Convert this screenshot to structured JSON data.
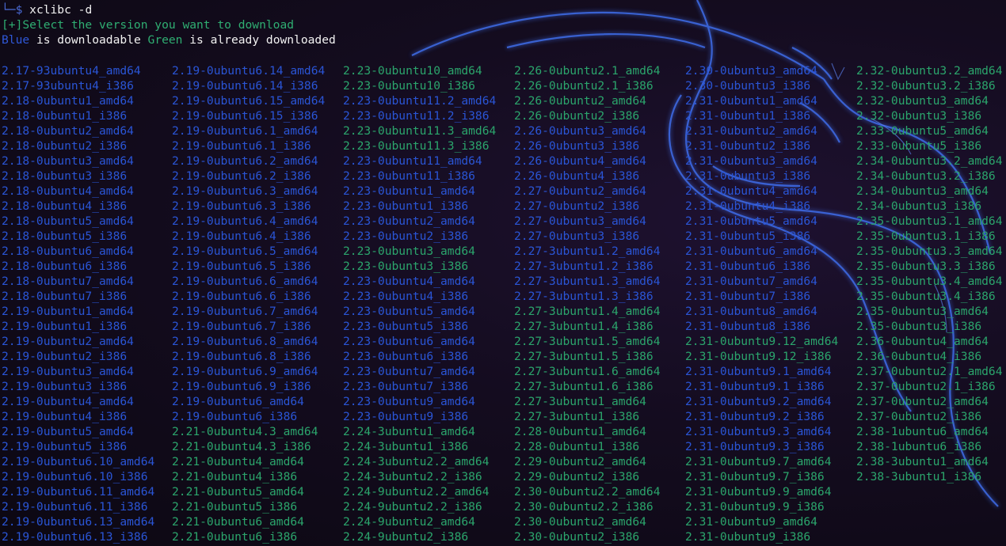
{
  "terminal": {
    "prompt_symbol": "└─$",
    "command": "xclibc -d",
    "message": "[+]Select the version you want to download",
    "legend": {
      "blue_word": "Blue",
      "blue_text": " is downloadable ",
      "green_word": "Green",
      "green_text": " is already downloaded"
    }
  },
  "colors": {
    "downloadable": "#2a55d6",
    "downloaded": "#2ba56c"
  },
  "columns": [
    {
      "items": [
        {
          "label": "2.17-93ubuntu4_amd64",
          "status": "blue"
        },
        {
          "label": "2.17-93ubuntu4_i386",
          "status": "blue"
        },
        {
          "label": "2.18-0ubuntu1_amd64",
          "status": "blue"
        },
        {
          "label": "2.18-0ubuntu1_i386",
          "status": "blue"
        },
        {
          "label": "2.18-0ubuntu2_amd64",
          "status": "blue"
        },
        {
          "label": "2.18-0ubuntu2_i386",
          "status": "blue"
        },
        {
          "label": "2.18-0ubuntu3_amd64",
          "status": "blue"
        },
        {
          "label": "2.18-0ubuntu3_i386",
          "status": "blue"
        },
        {
          "label": "2.18-0ubuntu4_amd64",
          "status": "blue"
        },
        {
          "label": "2.18-0ubuntu4_i386",
          "status": "blue"
        },
        {
          "label": "2.18-0ubuntu5_amd64",
          "status": "blue"
        },
        {
          "label": "2.18-0ubuntu5_i386",
          "status": "blue"
        },
        {
          "label": "2.18-0ubuntu6_amd64",
          "status": "blue"
        },
        {
          "label": "2.18-0ubuntu6_i386",
          "status": "blue"
        },
        {
          "label": "2.18-0ubuntu7_amd64",
          "status": "blue"
        },
        {
          "label": "2.18-0ubuntu7_i386",
          "status": "blue"
        },
        {
          "label": "2.19-0ubuntu1_amd64",
          "status": "blue"
        },
        {
          "label": "2.19-0ubuntu1_i386",
          "status": "blue"
        },
        {
          "label": "2.19-0ubuntu2_amd64",
          "status": "blue"
        },
        {
          "label": "2.19-0ubuntu2_i386",
          "status": "blue"
        },
        {
          "label": "2.19-0ubuntu3_amd64",
          "status": "blue"
        },
        {
          "label": "2.19-0ubuntu3_i386",
          "status": "blue"
        },
        {
          "label": "2.19-0ubuntu4_amd64",
          "status": "blue"
        },
        {
          "label": "2.19-0ubuntu4_i386",
          "status": "blue"
        },
        {
          "label": "2.19-0ubuntu5_amd64",
          "status": "blue"
        },
        {
          "label": "2.19-0ubuntu5_i386",
          "status": "blue"
        },
        {
          "label": "2.19-0ubuntu6.10_amd64",
          "status": "blue"
        },
        {
          "label": "2.19-0ubuntu6.10_i386",
          "status": "blue"
        },
        {
          "label": "2.19-0ubuntu6.11_amd64",
          "status": "blue"
        },
        {
          "label": "2.19-0ubuntu6.11_i386",
          "status": "blue"
        },
        {
          "label": "2.19-0ubuntu6.13_amd64",
          "status": "blue"
        },
        {
          "label": "2.19-0ubuntu6.13_i386",
          "status": "blue"
        }
      ]
    },
    {
      "items": [
        {
          "label": "2.19-0ubuntu6.14_amd64",
          "status": "blue"
        },
        {
          "label": "2.19-0ubuntu6.14_i386",
          "status": "blue"
        },
        {
          "label": "2.19-0ubuntu6.15_amd64",
          "status": "blue"
        },
        {
          "label": "2.19-0ubuntu6.15_i386",
          "status": "blue"
        },
        {
          "label": "2.19-0ubuntu6.1_amd64",
          "status": "blue"
        },
        {
          "label": "2.19-0ubuntu6.1_i386",
          "status": "blue"
        },
        {
          "label": "2.19-0ubuntu6.2_amd64",
          "status": "blue"
        },
        {
          "label": "2.19-0ubuntu6.2_i386",
          "status": "blue"
        },
        {
          "label": "2.19-0ubuntu6.3_amd64",
          "status": "blue"
        },
        {
          "label": "2.19-0ubuntu6.3_i386",
          "status": "blue"
        },
        {
          "label": "2.19-0ubuntu6.4_amd64",
          "status": "blue"
        },
        {
          "label": "2.19-0ubuntu6.4_i386",
          "status": "blue"
        },
        {
          "label": "2.19-0ubuntu6.5_amd64",
          "status": "blue"
        },
        {
          "label": "2.19-0ubuntu6.5_i386",
          "status": "blue"
        },
        {
          "label": "2.19-0ubuntu6.6_amd64",
          "status": "blue"
        },
        {
          "label": "2.19-0ubuntu6.6_i386",
          "status": "blue"
        },
        {
          "label": "2.19-0ubuntu6.7_amd64",
          "status": "blue"
        },
        {
          "label": "2.19-0ubuntu6.7_i386",
          "status": "blue"
        },
        {
          "label": "2.19-0ubuntu6.8_amd64",
          "status": "blue"
        },
        {
          "label": "2.19-0ubuntu6.8_i386",
          "status": "blue"
        },
        {
          "label": "2.19-0ubuntu6.9_amd64",
          "status": "blue"
        },
        {
          "label": "2.19-0ubuntu6.9_i386",
          "status": "blue"
        },
        {
          "label": "2.19-0ubuntu6_amd64",
          "status": "blue"
        },
        {
          "label": "2.19-0ubuntu6_i386",
          "status": "blue"
        },
        {
          "label": "2.21-0ubuntu4.3_amd64",
          "status": "green"
        },
        {
          "label": "2.21-0ubuntu4.3_i386",
          "status": "green"
        },
        {
          "label": "2.21-0ubuntu4_amd64",
          "status": "green"
        },
        {
          "label": "2.21-0ubuntu4_i386",
          "status": "green"
        },
        {
          "label": "2.21-0ubuntu5_amd64",
          "status": "green"
        },
        {
          "label": "2.21-0ubuntu5_i386",
          "status": "green"
        },
        {
          "label": "2.21-0ubuntu6_amd64",
          "status": "green"
        },
        {
          "label": "2.21-0ubuntu6_i386",
          "status": "green"
        }
      ]
    },
    {
      "items": [
        {
          "label": "2.23-0ubuntu10_amd64",
          "status": "green"
        },
        {
          "label": "2.23-0ubuntu10_i386",
          "status": "green"
        },
        {
          "label": "2.23-0ubuntu11.2_amd64",
          "status": "blue"
        },
        {
          "label": "2.23-0ubuntu11.2_i386",
          "status": "blue"
        },
        {
          "label": "2.23-0ubuntu11.3_amd64",
          "status": "green"
        },
        {
          "label": "2.23-0ubuntu11.3_i386",
          "status": "green"
        },
        {
          "label": "2.23-0ubuntu11_amd64",
          "status": "blue"
        },
        {
          "label": "2.23-0ubuntu11_i386",
          "status": "blue"
        },
        {
          "label": "2.23-0ubuntu1_amd64",
          "status": "blue"
        },
        {
          "label": "2.23-0ubuntu1_i386",
          "status": "blue"
        },
        {
          "label": "2.23-0ubuntu2_amd64",
          "status": "blue"
        },
        {
          "label": "2.23-0ubuntu2_i386",
          "status": "blue"
        },
        {
          "label": "2.23-0ubuntu3_amd64",
          "status": "green"
        },
        {
          "label": "2.23-0ubuntu3_i386",
          "status": "green"
        },
        {
          "label": "2.23-0ubuntu4_amd64",
          "status": "blue"
        },
        {
          "label": "2.23-0ubuntu4_i386",
          "status": "blue"
        },
        {
          "label": "2.23-0ubuntu5_amd64",
          "status": "blue"
        },
        {
          "label": "2.23-0ubuntu5_i386",
          "status": "blue"
        },
        {
          "label": "2.23-0ubuntu6_amd64",
          "status": "blue"
        },
        {
          "label": "2.23-0ubuntu6_i386",
          "status": "blue"
        },
        {
          "label": "2.23-0ubuntu7_amd64",
          "status": "blue"
        },
        {
          "label": "2.23-0ubuntu7_i386",
          "status": "blue"
        },
        {
          "label": "2.23-0ubuntu9_amd64",
          "status": "blue"
        },
        {
          "label": "2.23-0ubuntu9_i386",
          "status": "blue"
        },
        {
          "label": "2.24-3ubuntu1_amd64",
          "status": "green"
        },
        {
          "label": "2.24-3ubuntu1_i386",
          "status": "green"
        },
        {
          "label": "2.24-3ubuntu2.2_amd64",
          "status": "green"
        },
        {
          "label": "2.24-3ubuntu2.2_i386",
          "status": "green"
        },
        {
          "label": "2.24-9ubuntu2.2_amd64",
          "status": "green"
        },
        {
          "label": "2.24-9ubuntu2.2_i386",
          "status": "green"
        },
        {
          "label": "2.24-9ubuntu2_amd64",
          "status": "green"
        },
        {
          "label": "2.24-9ubuntu2_i386",
          "status": "green"
        }
      ]
    },
    {
      "items": [
        {
          "label": "2.26-0ubuntu2.1_amd64",
          "status": "green"
        },
        {
          "label": "2.26-0ubuntu2.1_i386",
          "status": "green"
        },
        {
          "label": "2.26-0ubuntu2_amd64",
          "status": "green"
        },
        {
          "label": "2.26-0ubuntu2_i386",
          "status": "green"
        },
        {
          "label": "2.26-0ubuntu3_amd64",
          "status": "blue"
        },
        {
          "label": "2.26-0ubuntu3_i386",
          "status": "blue"
        },
        {
          "label": "2.26-0ubuntu4_amd64",
          "status": "blue"
        },
        {
          "label": "2.26-0ubuntu4_i386",
          "status": "blue"
        },
        {
          "label": "2.27-0ubuntu2_amd64",
          "status": "blue"
        },
        {
          "label": "2.27-0ubuntu2_i386",
          "status": "blue"
        },
        {
          "label": "2.27-0ubuntu3_amd64",
          "status": "blue"
        },
        {
          "label": "2.27-0ubuntu3_i386",
          "status": "blue"
        },
        {
          "label": "2.27-3ubuntu1.2_amd64",
          "status": "blue"
        },
        {
          "label": "2.27-3ubuntu1.2_i386",
          "status": "blue"
        },
        {
          "label": "2.27-3ubuntu1.3_amd64",
          "status": "blue"
        },
        {
          "label": "2.27-3ubuntu1.3_i386",
          "status": "blue"
        },
        {
          "label": "2.27-3ubuntu1.4_amd64",
          "status": "green"
        },
        {
          "label": "2.27-3ubuntu1.4_i386",
          "status": "green"
        },
        {
          "label": "2.27-3ubuntu1.5_amd64",
          "status": "green"
        },
        {
          "label": "2.27-3ubuntu1.5_i386",
          "status": "green"
        },
        {
          "label": "2.27-3ubuntu1.6_amd64",
          "status": "green"
        },
        {
          "label": "2.27-3ubuntu1.6_i386",
          "status": "green"
        },
        {
          "label": "2.27-3ubuntu1_amd64",
          "status": "green"
        },
        {
          "label": "2.27-3ubuntu1_i386",
          "status": "green"
        },
        {
          "label": "2.28-0ubuntu1_amd64",
          "status": "green"
        },
        {
          "label": "2.28-0ubuntu1_i386",
          "status": "green"
        },
        {
          "label": "2.29-0ubuntu2_amd64",
          "status": "green"
        },
        {
          "label": "2.29-0ubuntu2_i386",
          "status": "green"
        },
        {
          "label": "2.30-0ubuntu2.2_amd64",
          "status": "green"
        },
        {
          "label": "2.30-0ubuntu2.2_i386",
          "status": "green"
        },
        {
          "label": "2.30-0ubuntu2_amd64",
          "status": "green"
        },
        {
          "label": "2.30-0ubuntu2_i386",
          "status": "green"
        }
      ]
    },
    {
      "items": [
        {
          "label": "2.30-0ubuntu3_amd64",
          "status": "blue"
        },
        {
          "label": "2.30-0ubuntu3_i386",
          "status": "blue"
        },
        {
          "label": "2.31-0ubuntu1_amd64",
          "status": "blue"
        },
        {
          "label": "2.31-0ubuntu1_i386",
          "status": "blue"
        },
        {
          "label": "2.31-0ubuntu2_amd64",
          "status": "blue"
        },
        {
          "label": "2.31-0ubuntu2_i386",
          "status": "blue"
        },
        {
          "label": "2.31-0ubuntu3_amd64",
          "status": "blue"
        },
        {
          "label": "2.31-0ubuntu3_i386",
          "status": "blue"
        },
        {
          "label": "2.31-0ubuntu4_amd64",
          "status": "blue"
        },
        {
          "label": "2.31-0ubuntu4_i386",
          "status": "blue"
        },
        {
          "label": "2.31-0ubuntu5_amd64",
          "status": "blue"
        },
        {
          "label": "2.31-0ubuntu5_i386",
          "status": "blue"
        },
        {
          "label": "2.31-0ubuntu6_amd64",
          "status": "blue"
        },
        {
          "label": "2.31-0ubuntu6_i386",
          "status": "blue"
        },
        {
          "label": "2.31-0ubuntu7_amd64",
          "status": "blue"
        },
        {
          "label": "2.31-0ubuntu7_i386",
          "status": "blue"
        },
        {
          "label": "2.31-0ubuntu8_amd64",
          "status": "blue"
        },
        {
          "label": "2.31-0ubuntu8_i386",
          "status": "blue"
        },
        {
          "label": "2.31-0ubuntu9.12_amd64",
          "status": "green"
        },
        {
          "label": "2.31-0ubuntu9.12_i386",
          "status": "green"
        },
        {
          "label": "2.31-0ubuntu9.1_amd64",
          "status": "blue"
        },
        {
          "label": "2.31-0ubuntu9.1_i386",
          "status": "blue"
        },
        {
          "label": "2.31-0ubuntu9.2_amd64",
          "status": "blue"
        },
        {
          "label": "2.31-0ubuntu9.2_i386",
          "status": "blue"
        },
        {
          "label": "2.31-0ubuntu9.3_amd64",
          "status": "blue"
        },
        {
          "label": "2.31-0ubuntu9.3_i386",
          "status": "blue"
        },
        {
          "label": "2.31-0ubuntu9.7_amd64",
          "status": "green"
        },
        {
          "label": "2.31-0ubuntu9.7_i386",
          "status": "green"
        },
        {
          "label": "2.31-0ubuntu9.9_amd64",
          "status": "green"
        },
        {
          "label": "2.31-0ubuntu9.9_i386",
          "status": "green"
        },
        {
          "label": "2.31-0ubuntu9_amd64",
          "status": "green"
        },
        {
          "label": "2.31-0ubuntu9_i386",
          "status": "green"
        }
      ]
    },
    {
      "items": [
        {
          "label": "2.32-0ubuntu3.2_amd64",
          "status": "green"
        },
        {
          "label": "2.32-0ubuntu3.2_i386",
          "status": "green"
        },
        {
          "label": "2.32-0ubuntu3_amd64",
          "status": "green"
        },
        {
          "label": "2.32-0ubuntu3_i386",
          "status": "green"
        },
        {
          "label": "2.33-0ubuntu5_amd64",
          "status": "green"
        },
        {
          "label": "2.33-0ubuntu5_i386",
          "status": "green"
        },
        {
          "label": "2.34-0ubuntu3.2_amd64",
          "status": "green"
        },
        {
          "label": "2.34-0ubuntu3.2_i386",
          "status": "green"
        },
        {
          "label": "2.34-0ubuntu3_amd64",
          "status": "green"
        },
        {
          "label": "2.34-0ubuntu3_i386",
          "status": "green"
        },
        {
          "label": "2.35-0ubuntu3.1_amd64",
          "status": "green"
        },
        {
          "label": "2.35-0ubuntu3.1_i386",
          "status": "green"
        },
        {
          "label": "2.35-0ubuntu3.3_amd64",
          "status": "green"
        },
        {
          "label": "2.35-0ubuntu3.3_i386",
          "status": "green"
        },
        {
          "label": "2.35-0ubuntu3.4_amd64",
          "status": "green"
        },
        {
          "label": "2.35-0ubuntu3.4_i386",
          "status": "green"
        },
        {
          "label": "2.35-0ubuntu3_amd64",
          "status": "green"
        },
        {
          "label": "2.35-0ubuntu3_i386",
          "status": "green"
        },
        {
          "label": "2.36-0ubuntu4_amd64",
          "status": "green"
        },
        {
          "label": "2.36-0ubuntu4_i386",
          "status": "green"
        },
        {
          "label": "2.37-0ubuntu2.1_amd64",
          "status": "green"
        },
        {
          "label": "2.37-0ubuntu2.1_i386",
          "status": "green"
        },
        {
          "label": "2.37-0ubuntu2_amd64",
          "status": "green"
        },
        {
          "label": "2.37-0ubuntu2_i386",
          "status": "green"
        },
        {
          "label": "2.38-1ubuntu6_amd64",
          "status": "green"
        },
        {
          "label": "2.38-1ubuntu6_i386",
          "status": "green"
        },
        {
          "label": "2.38-3ubuntu1_amd64",
          "status": "green"
        },
        {
          "label": "2.38-3ubuntu1_i386",
          "status": "green"
        }
      ]
    }
  ]
}
